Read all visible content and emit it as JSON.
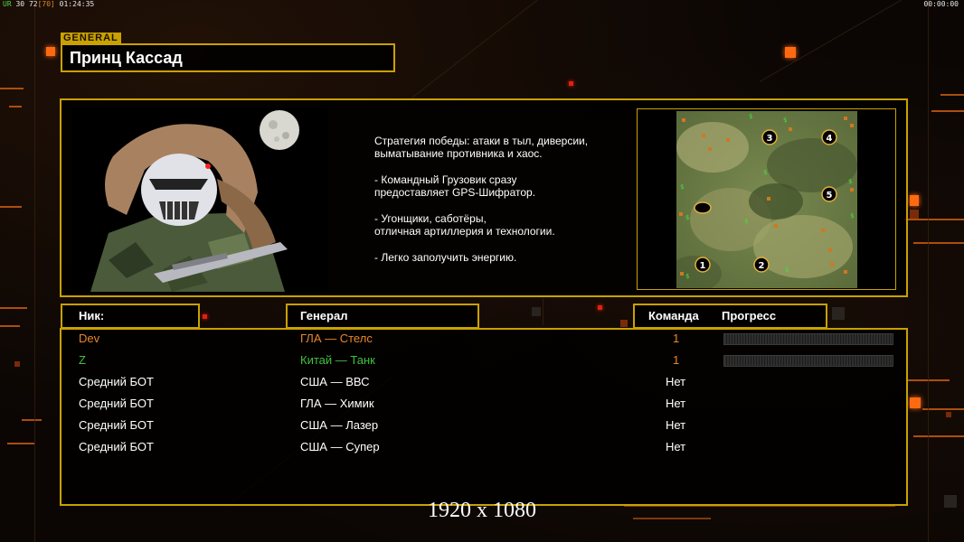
{
  "hud": {
    "fps_label": "UR",
    "fps_value": "30",
    "stat_a": "72",
    "stat_b": "[70]",
    "elapsed": "01:24:35",
    "clock": "00:00:00"
  },
  "general": {
    "tag": "GENERAL",
    "name": "Принц Кассад"
  },
  "strategy": [
    "Стратегия победы: атаки в тыл, диверсии,\n выматывание противника и хаос.",
    "- Командный Грузовик сразу\nпредоставляет GPS-Шифратор.",
    "- Угонщики, саботёры,\nотличная артиллерия и технологии.",
    "- Легко заполучить энергию."
  ],
  "map": {
    "start_positions": [
      "1",
      "2",
      "3",
      "4",
      "5"
    ]
  },
  "headers": {
    "nick": "Ник:",
    "general": "Генерал",
    "team": "Команда",
    "progress": "Прогресс"
  },
  "players": [
    {
      "nick": "Dev",
      "general": "ГЛА — Стелс",
      "team": "1",
      "color": "#e8862a",
      "has_progress": true
    },
    {
      "nick": "Z",
      "general": "Китай — Танк",
      "team": "1",
      "color": "#40c040",
      "has_progress": true
    },
    {
      "nick": "Средний БОТ",
      "general": "США — ВВС",
      "team": "Нет",
      "color": "#ffffff",
      "has_progress": false
    },
    {
      "nick": "Средний БОТ",
      "general": "ГЛА — Химик",
      "team": "Нет",
      "color": "#ffffff",
      "has_progress": false
    },
    {
      "nick": "Средний БОТ",
      "general": "США — Лазер",
      "team": "Нет",
      "color": "#ffffff",
      "has_progress": false
    },
    {
      "nick": "Средний БОТ",
      "general": "США — Супер",
      "team": "Нет",
      "color": "#ffffff",
      "has_progress": false
    }
  ],
  "resolution": "1920 x 1080",
  "colors": {
    "frame": "#c9a100",
    "accent": "#ff6a10"
  }
}
